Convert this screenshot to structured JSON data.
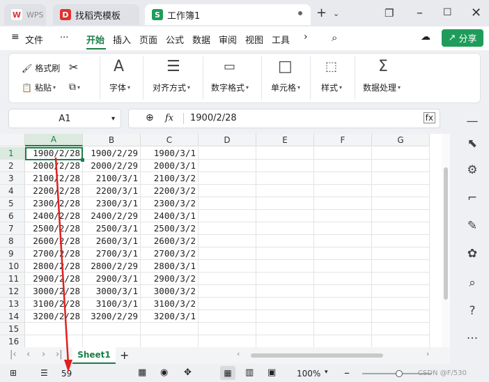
{
  "tabs": {
    "wps": "WPS",
    "template": "找稻壳模板",
    "workbook": "工作簿1",
    "template_icon": "D",
    "workbook_icon": "S"
  },
  "menu": {
    "file": "文件",
    "more": "···",
    "items": [
      "开始",
      "插入",
      "页面",
      "公式",
      "数据",
      "审阅",
      "视图",
      "工具"
    ],
    "share": "分享"
  },
  "toolbar": {
    "format_painter": "格式刷",
    "paste": "粘贴",
    "font": "字体",
    "align": "对齐方式",
    "number_format": "数字格式",
    "cell": "单元格",
    "style": "样式",
    "data_process": "数据处理"
  },
  "formula": {
    "name_box": "A1",
    "fx": "fx",
    "value": "1900/2/28"
  },
  "columns": [
    "A",
    "B",
    "C",
    "D",
    "E",
    "F",
    "G"
  ],
  "rows": [
    "1",
    "2",
    "3",
    "4",
    "5",
    "6",
    "7",
    "8",
    "9",
    "10",
    "11",
    "12",
    "13",
    "14",
    "15",
    "16"
  ],
  "cells": [
    [
      "1900/2/28",
      "1900/2/29",
      "1900/3/1"
    ],
    [
      "2000/2/28",
      "2000/2/29",
      "2000/3/1"
    ],
    [
      "2100/2/28",
      "2100/3/1",
      "2100/3/2"
    ],
    [
      "2200/2/28",
      "2200/3/1",
      "2200/3/2"
    ],
    [
      "2300/2/28",
      "2300/3/1",
      "2300/3/2"
    ],
    [
      "2400/2/28",
      "2400/2/29",
      "2400/3/1"
    ],
    [
      "2500/2/28",
      "2500/3/1",
      "2500/3/2"
    ],
    [
      "2600/2/28",
      "2600/3/1",
      "2600/3/2"
    ],
    [
      "2700/2/28",
      "2700/3/1",
      "2700/3/2"
    ],
    [
      "2800/2/28",
      "2800/2/29",
      "2800/3/1"
    ],
    [
      "2900/2/28",
      "2900/3/1",
      "2900/3/2"
    ],
    [
      "3000/2/28",
      "3000/3/1",
      "3000/3/2"
    ],
    [
      "3100/2/28",
      "3100/3/1",
      "3100/3/2"
    ],
    [
      "3200/2/28",
      "3200/2/29",
      "3200/3/1"
    ]
  ],
  "sheet": {
    "name": "Sheet1",
    "add": "+"
  },
  "status": {
    "count": "59",
    "zoom": "100%",
    "watermark": "CSDN @F/530"
  },
  "colors": {
    "accent": "#1a7f46",
    "arrow": "#e02020"
  }
}
